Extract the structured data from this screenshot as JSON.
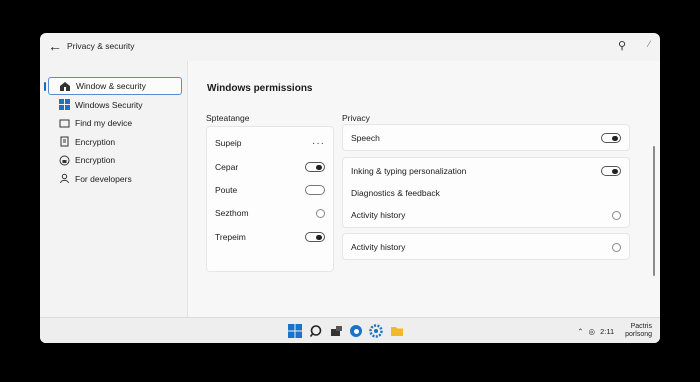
{
  "window": {
    "title": "Privacy & security"
  },
  "sidebar": {
    "items": [
      {
        "label": "Window & security",
        "icon": "shield-house-icon",
        "active": true
      },
      {
        "label": "Windows Security",
        "icon": "windows-logo-icon"
      },
      {
        "label": "Find my device",
        "icon": "device-icon"
      },
      {
        "label": "Encryption",
        "icon": "document-icon"
      },
      {
        "label": "Encryption",
        "icon": "lock-icon"
      },
      {
        "label": "For developers",
        "icon": "developer-icon"
      }
    ]
  },
  "main": {
    "heading": "Windows permissions",
    "left_column": {
      "title": "Spteatange",
      "rows": [
        {
          "label": "Supeip",
          "control": "more"
        },
        {
          "label": "Cepar",
          "control": "toggle-on"
        },
        {
          "label": "Poute",
          "control": "toggle-off"
        },
        {
          "label": "Sezthom",
          "control": "radio"
        },
        {
          "label": "Trepeim",
          "control": "toggle-on"
        }
      ]
    },
    "right_column": {
      "title": "Privacy",
      "card1": {
        "label": "Speech"
      },
      "card2": {
        "row1": "Inking & typing personalization",
        "row2": "Diagnostics & feedback",
        "row3": "Activity history"
      },
      "card3": {
        "label": "Activity history"
      }
    }
  },
  "taskbar": {
    "clock_time": "2:11",
    "clock_line1": "Pactris",
    "clock_line2": "porlsong"
  },
  "colors": {
    "accent": "#0f6cbd"
  }
}
